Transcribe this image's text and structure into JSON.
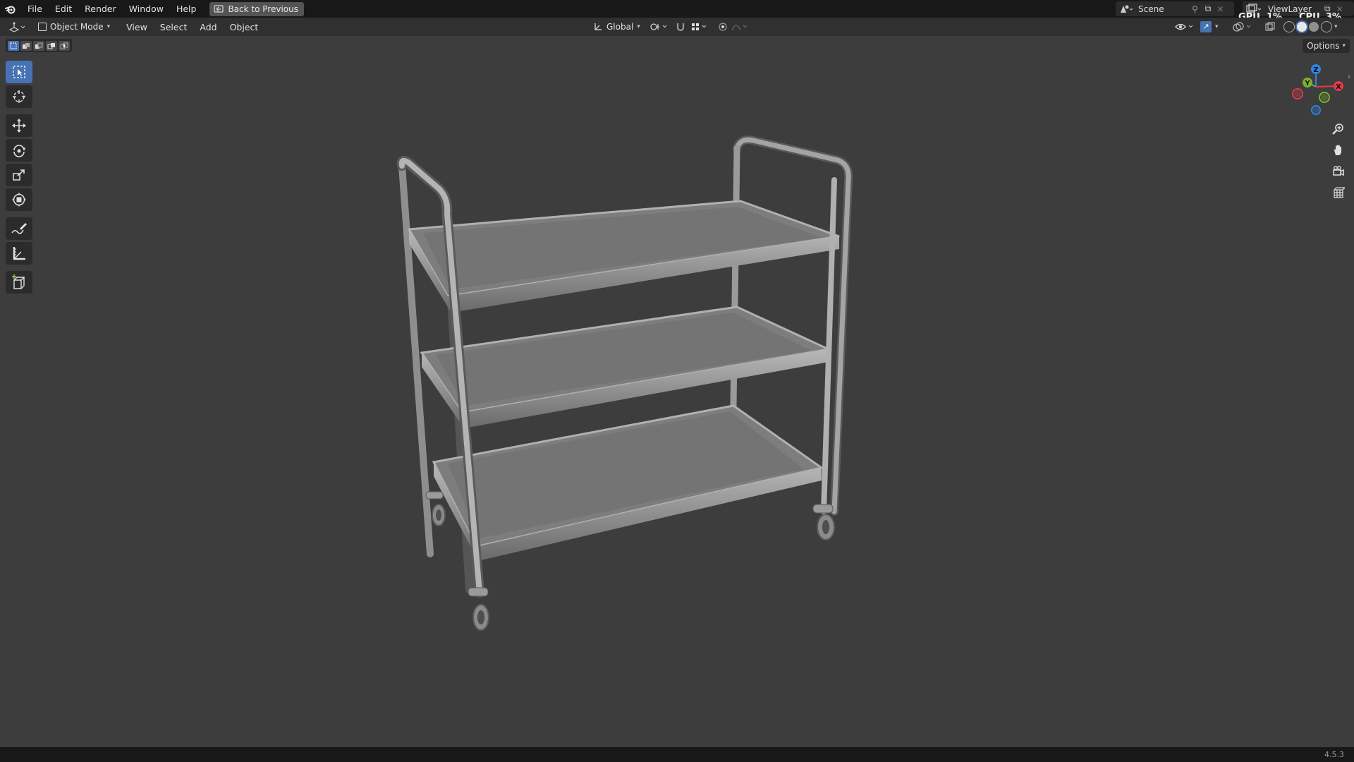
{
  "topbar": {
    "menus": [
      "File",
      "Edit",
      "Render",
      "Window",
      "Help"
    ],
    "back_button": "Back to Previous",
    "scene": "Scene",
    "view_layer": "ViewLayer",
    "gpu_label": "GPU",
    "gpu_value": "1%",
    "cpu_label": "CPU",
    "cpu_value": "3%"
  },
  "header": {
    "mode": "Object Mode",
    "menus": [
      "View",
      "Select",
      "Add",
      "Object"
    ],
    "orientation": "Global"
  },
  "viewport": {
    "options": "Options",
    "gizmo": {
      "x": "X",
      "y": "Y",
      "z": "Z"
    }
  },
  "toolbar": {
    "tools": [
      "select-box",
      "cursor",
      "move",
      "rotate",
      "scale",
      "transform",
      "annotate",
      "measure",
      "add-cube"
    ],
    "active_tool": "select-box"
  },
  "status": {
    "version": "4.5.3"
  },
  "colors": {
    "accent": "#4772b3",
    "axis_x": "#e2394e",
    "axis_y": "#7cb22a",
    "axis_z": "#2e84e3",
    "background": "#3d3d3d"
  }
}
